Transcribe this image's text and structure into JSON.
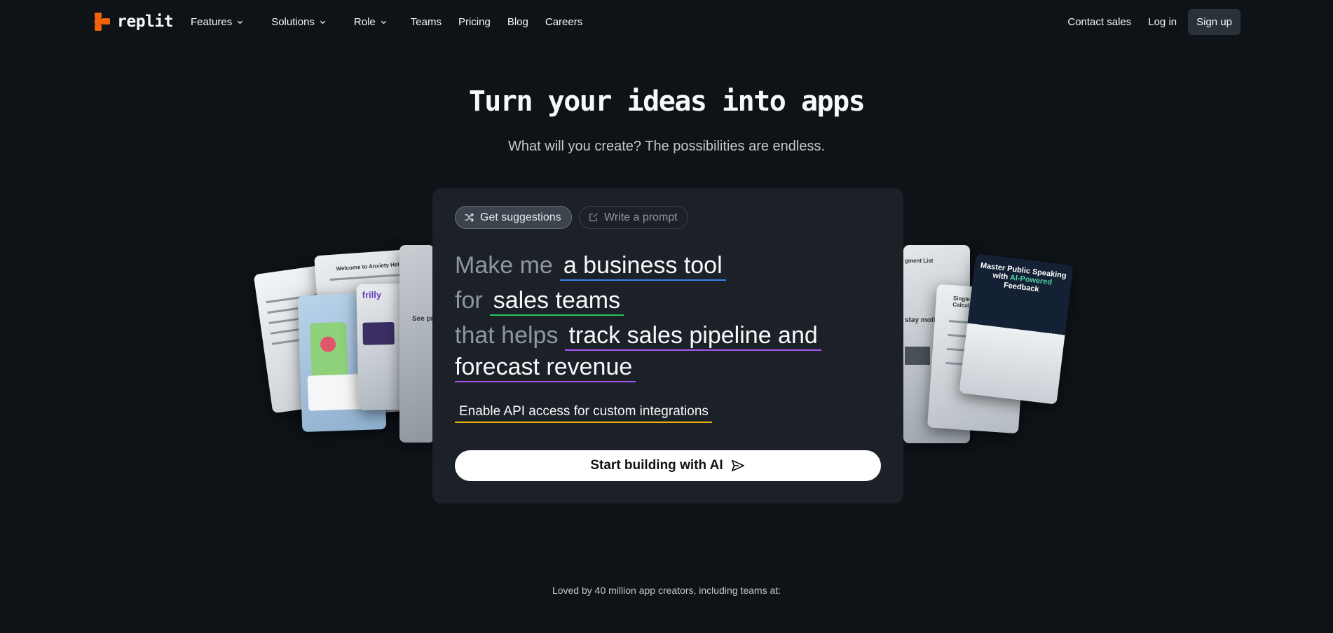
{
  "brand": {
    "name": "replit",
    "accent": "#f26207"
  },
  "nav": {
    "items": [
      {
        "label": "Features",
        "has_dropdown": true
      },
      {
        "label": "Solutions",
        "has_dropdown": true
      },
      {
        "label": "Role",
        "has_dropdown": true
      },
      {
        "label": "Teams",
        "has_dropdown": false
      },
      {
        "label": "Pricing",
        "has_dropdown": false
      },
      {
        "label": "Blog",
        "has_dropdown": false
      },
      {
        "label": "Careers",
        "has_dropdown": false
      }
    ],
    "contact_sales": "Contact sales",
    "login": "Log in",
    "signup": "Sign up"
  },
  "hero": {
    "title": "Turn your ideas into apps",
    "subtitle": "What will you create? The possibilities are endless."
  },
  "prompt_panel": {
    "tabs": [
      {
        "label": "Get suggestions",
        "icon": "shuffle-icon",
        "active": true
      },
      {
        "label": "Write a prompt",
        "icon": "edit-icon",
        "active": false
      }
    ],
    "line1_prefix": "Make me",
    "line1_value": "a business tool",
    "line2_prefix": "for",
    "line2_value": "sales teams",
    "line3_prefix": "that helps",
    "line3_value": "track sales pipeline and",
    "line4_value": "forecast revenue",
    "extra": "Enable API access for custom integrations",
    "cta": "Start building with AI",
    "cta_icon": "send-icon",
    "colors": {
      "blue": "#3b82f6",
      "green": "#22c55e",
      "purple": "#a855f7",
      "yellow": "#eab308"
    }
  },
  "cards": {
    "anxiety_helper": "Welcome to Anxiety Helper",
    "frilly": "frilly",
    "see_pr": "See pr",
    "stay_motivated": "stay motivated",
    "assignment_list": "gment List",
    "loan_calc": "Single Property Loan Calculator",
    "speaking": "Master Public Speaking with",
    "speaking_accent": "AI-Powered",
    "speaking_end": "Feedback"
  },
  "footer_text": "Loved by 40 million app creators, including teams at:"
}
